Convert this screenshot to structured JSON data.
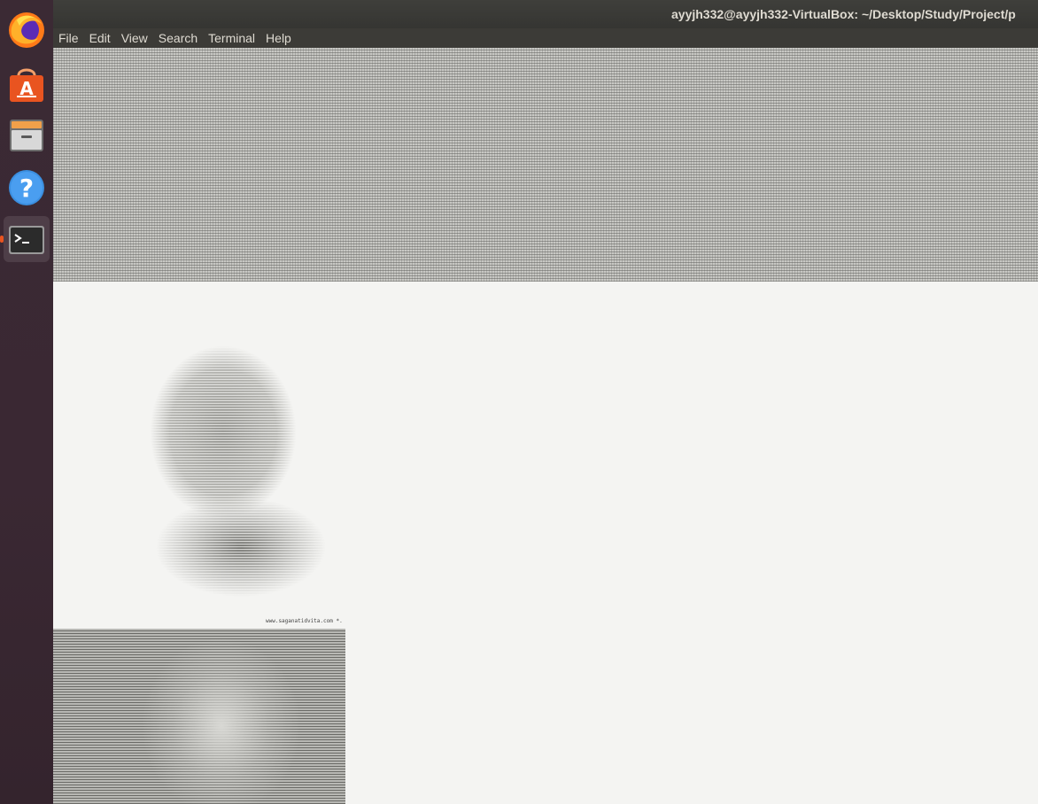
{
  "window": {
    "title": "ayyjh332@ayyjh332-VirtualBox: ~/Desktop/Study/Project/p"
  },
  "menubar": {
    "items": [
      "File",
      "Edit",
      "View",
      "Search",
      "Terminal",
      "Help"
    ]
  },
  "dock": {
    "items": [
      {
        "name": "firefox-icon"
      },
      {
        "name": "software-center-icon"
      },
      {
        "name": "file-cabinet-icon"
      },
      {
        "name": "help-icon"
      },
      {
        "name": "terminal-icon"
      }
    ]
  },
  "terminal": {
    "credit_text": "www.saganatidvita.com *."
  },
  "colors": {
    "titlebar": "#3c3b37",
    "terminal_bg": "#f4f4f2",
    "accent": "#e95420"
  }
}
